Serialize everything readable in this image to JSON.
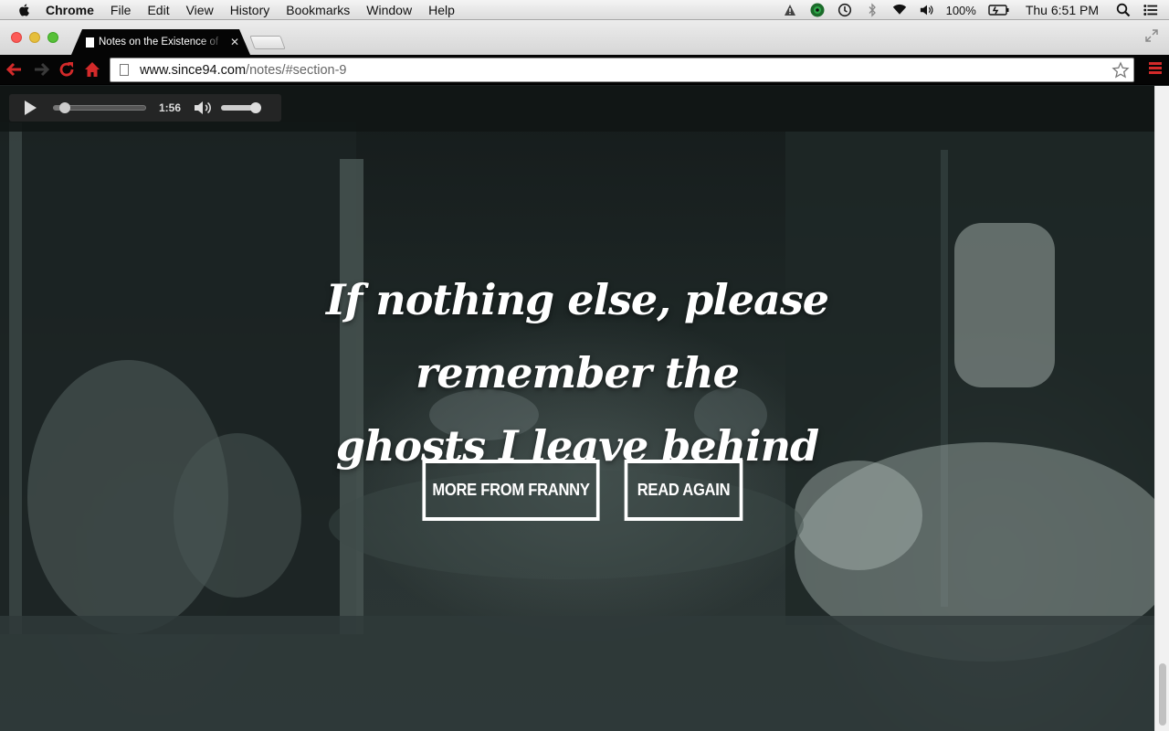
{
  "menubar": {
    "app_name": "Chrome",
    "menus": [
      "File",
      "Edit",
      "View",
      "History",
      "Bookmarks",
      "Window",
      "Help"
    ],
    "battery": "100%",
    "clock": "Thu 6:51 PM",
    "status_icons": [
      "alert-icon",
      "globe-icon",
      "time-machine-icon",
      "bluetooth-icon",
      "wifi-icon",
      "volume-icon",
      "battery-icon",
      "spotlight-icon",
      "notification-center-icon"
    ]
  },
  "browser": {
    "tab_title": "Notes on the Existence of",
    "url_host": "www.since94.com",
    "url_path": "/notes/#section-9"
  },
  "player": {
    "time": "1:56",
    "progress_fraction": 0.07,
    "volume_fraction": 1.0
  },
  "hero": {
    "quote_line1": "If nothing else, please remember the",
    "quote_line2": "ghosts I leave behind",
    "buttons": {
      "more": "MORE FROM FRANNY",
      "again": "READ AGAIN"
    }
  },
  "colors": {
    "toolbar_icons": "#d32a2a",
    "toolbar_bg": "#050505"
  }
}
